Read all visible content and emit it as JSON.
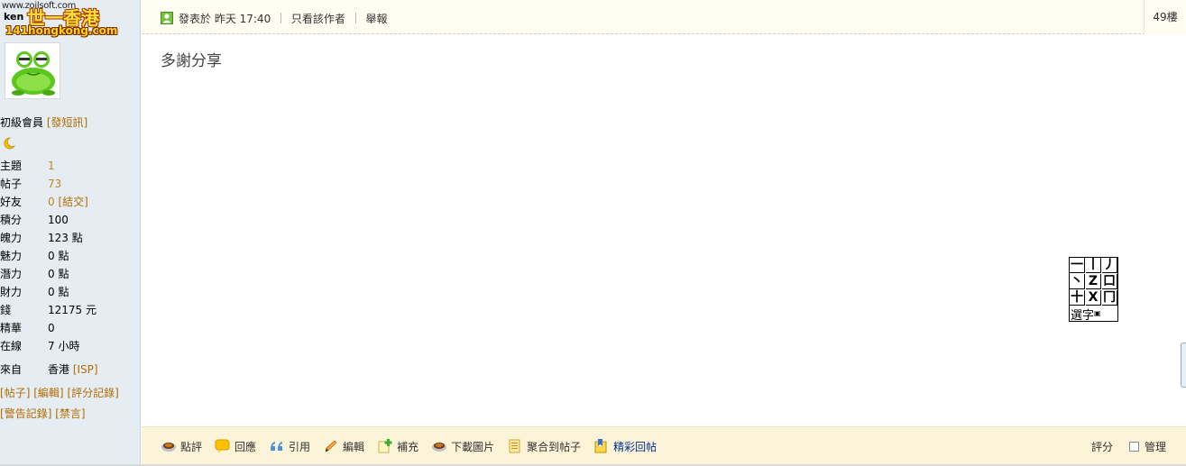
{
  "watermark": {
    "small_url": "www.zoilsoft.com",
    "username_fragment": "ken",
    "brand": "一香港",
    "brand_prefix": "世",
    "site": "141hongkong.com"
  },
  "profile": {
    "rank": "初級會員",
    "message_link": "發短訊",
    "stats": [
      {
        "label": "主題",
        "value": "1",
        "style": "orange"
      },
      {
        "label": "帖子",
        "value": "73",
        "style": "orange"
      },
      {
        "label": "好友",
        "value": "0",
        "extra": "結交",
        "style": "orange"
      },
      {
        "label": "積分",
        "value": "100",
        "style": "plain"
      },
      {
        "label": "魄力",
        "value": "123 點",
        "style": "plain"
      },
      {
        "label": "魅力",
        "value": "0 點",
        "style": "plain"
      },
      {
        "label": "潛力",
        "value": "0 點",
        "style": "plain"
      },
      {
        "label": "財力",
        "value": "0 點",
        "style": "plain"
      },
      {
        "label": "錢",
        "value": "12175 元",
        "style": "plain"
      },
      {
        "label": "精華",
        "value": "0",
        "style": "plain"
      },
      {
        "label": "在線",
        "value": "7 小時",
        "style": "plain"
      },
      {
        "label": "來自",
        "value": "香港",
        "extra": "ISP",
        "style": "plain"
      }
    ],
    "links_row1": [
      "帖子",
      "編輯",
      "評分記錄"
    ],
    "links_row2": [
      "警告記錄",
      "禁言"
    ]
  },
  "post": {
    "posted_label": "發表於 昨天 17:40",
    "author_only": "只看該作者",
    "report": "舉報",
    "floor": "49樓",
    "content": "多謝分享"
  },
  "ime": {
    "cells": [
      "一",
      "丨",
      "丿",
      "丶",
      "Z",
      "口",
      "十",
      "X",
      "冂"
    ],
    "label": "選字"
  },
  "actions": [
    {
      "label": "點評",
      "icon": "coffee-icon"
    },
    {
      "label": "回應",
      "icon": "speech-bubble-icon"
    },
    {
      "label": "引用",
      "icon": "quote-icon"
    },
    {
      "label": "編輯",
      "icon": "pencil-icon"
    },
    {
      "label": "補充",
      "icon": "add-note-icon"
    },
    {
      "label": "下載圖片",
      "icon": "coffee-icon"
    },
    {
      "label": "聚合到帖子",
      "icon": "document-icon"
    },
    {
      "label": "精彩回帖",
      "icon": "book-icon"
    }
  ],
  "right_actions": {
    "rate": "評分",
    "manage": "管理"
  }
}
